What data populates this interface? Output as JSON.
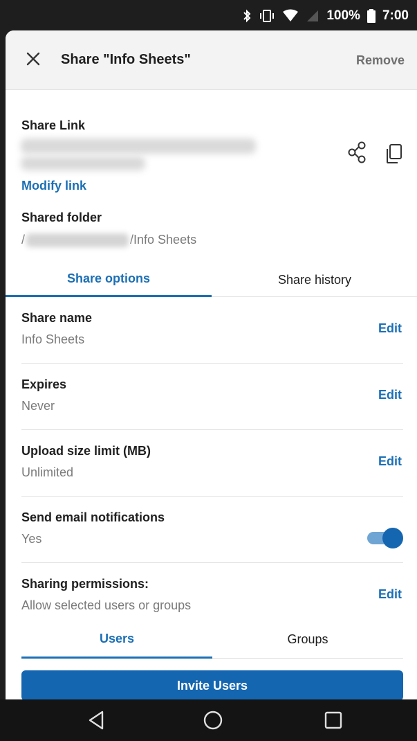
{
  "status_bar": {
    "battery": "100%",
    "time": "7:00",
    "icons": [
      "bluetooth-icon",
      "vibrate-icon",
      "wifi-icon",
      "signal-icon",
      "battery-icon"
    ]
  },
  "header": {
    "title": "Share \"Info Sheets\"",
    "remove_label": "Remove"
  },
  "share_link": {
    "label": "Share Link",
    "modify_label": "Modify link"
  },
  "shared_folder": {
    "label": "Shared folder",
    "path_prefix": "/",
    "path_suffix": "/Info Sheets"
  },
  "tabs": [
    {
      "label": "Share options",
      "active": true
    },
    {
      "label": "Share history",
      "active": false
    }
  ],
  "settings": [
    {
      "label": "Share name",
      "value": "Info Sheets",
      "action": "Edit"
    },
    {
      "label": "Expires",
      "value": "Never",
      "action": "Edit"
    },
    {
      "label": "Upload size limit (MB)",
      "value": "Unlimited",
      "action": "Edit"
    },
    {
      "label": "Send email notifications",
      "value": "Yes",
      "toggle_on": true
    },
    {
      "label": "Sharing permissions:",
      "value": "Allow selected users or groups",
      "action": "Edit"
    }
  ],
  "subtabs": [
    {
      "label": "Users",
      "active": true
    },
    {
      "label": "Groups",
      "active": false
    }
  ],
  "invite_label": "Invite Users",
  "colors": {
    "accent": "#1b6fb5",
    "button": "#1566b0",
    "header_bg": "#f3f3f3"
  }
}
